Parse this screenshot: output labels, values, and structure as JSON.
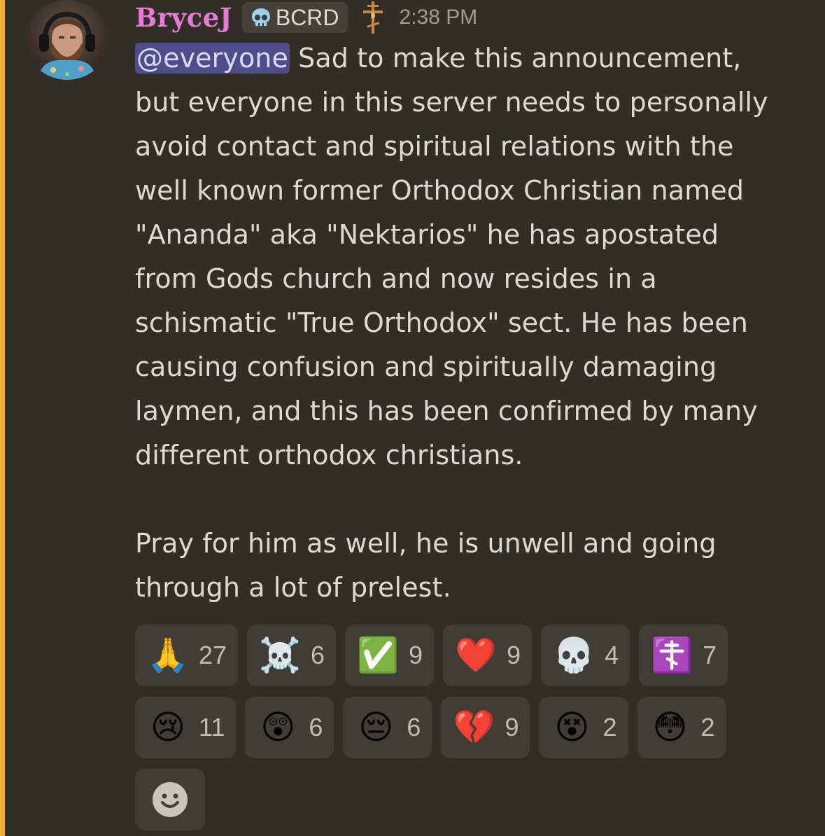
{
  "message": {
    "author": "BryceJ",
    "tag_icon": "skull-icon",
    "tag_label": "BCRD",
    "role_icon": "orthodox-cross-icon",
    "timestamp": "2:38 PM",
    "mention": "@everyone",
    "line_1": "Sad to make this announcement,",
    "lines": [
      "but everyone in this server needs to personally",
      "avoid contact and spiritual relations with the",
      "well known former Orthodox Christian named",
      "\"Ananda\" aka \"Nektarios\" he has apostated",
      "from Gods church and now resides in a",
      "schismatic \"True Orthodox\" sect. He has been",
      "causing confusion and spiritually damaging",
      "laymen, and this has been confirmed by many",
      "different orthodox christians."
    ],
    "paragraph_2": [
      "Pray for him as well, he is unwell and going",
      "through a lot of prelest."
    ]
  },
  "reactions": {
    "row_1": [
      {
        "emoji": "🙏",
        "icon": "folded-hands-icon",
        "count": "27"
      },
      {
        "emoji": "☠️",
        "icon": "skull-crossbones-icon",
        "count": "6"
      },
      {
        "emoji": "✅",
        "icon": "check-mark-icon",
        "count": "9"
      },
      {
        "emoji": "❤️",
        "icon": "red-heart-icon",
        "count": "9"
      },
      {
        "emoji": "💀",
        "icon": "skull-icon",
        "count": "4"
      },
      {
        "emoji": "☦️",
        "icon": "orthodox-cross-icon",
        "count": "7"
      }
    ],
    "row_2": [
      {
        "emoji": "😢",
        "icon": "crying-face-icon",
        "count": "11"
      },
      {
        "emoji": "😲",
        "icon": "astonished-face-icon",
        "count": "6"
      },
      {
        "emoji": "😔",
        "icon": "pensive-face-icon",
        "count": "6"
      },
      {
        "emoji": "💔",
        "icon": "broken-heart-icon",
        "count": "9"
      },
      {
        "emoji": "😵",
        "icon": "dizzy-face-icon",
        "count": "2"
      },
      {
        "emoji": "😳",
        "icon": "flushed-face-icon",
        "count": "2"
      }
    ],
    "add_reaction_icon": "add-reaction-smile-icon"
  },
  "colors": {
    "background": "#312d27",
    "mention_bar": "#f0b132",
    "username": "#e97ad6",
    "mention_highlight": "#4e4d8c",
    "reaction_bg": "#403c36"
  }
}
